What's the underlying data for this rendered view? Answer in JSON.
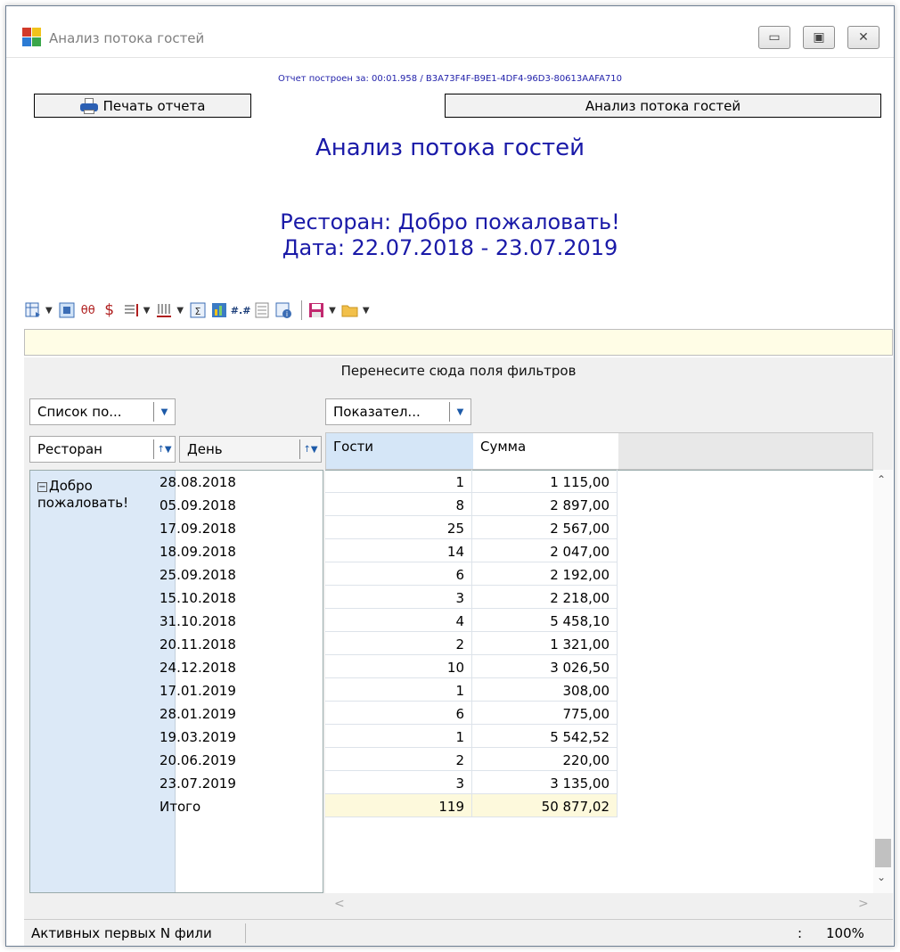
{
  "window": {
    "title": "Анализ потока гостей",
    "controls": [
      "minimize",
      "maximize",
      "close"
    ]
  },
  "report": {
    "meta": "Отчет построен за: 00:01.958 / B3A73F4F-B9E1-4DF4-96D3-80613AAFA710",
    "print_button": "Печать отчета",
    "report_button": "Анализ потока гостей",
    "title": "Анализ потока гостей",
    "restaurant_line": "Ресторан: Добро пожаловать!",
    "date_line": "Дата: 22.07.2018 - 23.07.2019"
  },
  "pivot": {
    "filter_drop_hint": "Перенесите сюда поля фильтров",
    "fields_list_button": "Список по...",
    "measures_button": "Показател...",
    "row_fields": [
      "Ресторан",
      "День"
    ],
    "column_headers": [
      "Гости",
      "Сумма"
    ],
    "restaurant": "Добро пожаловать!",
    "rows": [
      {
        "date": "28.08.2018",
        "guests": "1",
        "sum": "1 115,00"
      },
      {
        "date": "05.09.2018",
        "guests": "8",
        "sum": "2 897,00"
      },
      {
        "date": "17.09.2018",
        "guests": "25",
        "sum": "2 567,00"
      },
      {
        "date": "18.09.2018",
        "guests": "14",
        "sum": "2 047,00"
      },
      {
        "date": "25.09.2018",
        "guests": "6",
        "sum": "2 192,00"
      },
      {
        "date": "15.10.2018",
        "guests": "3",
        "sum": "2 218,00"
      },
      {
        "date": "31.10.2018",
        "guests": "4",
        "sum": "5 458,10"
      },
      {
        "date": "20.11.2018",
        "guests": "2",
        "sum": "1 321,00"
      },
      {
        "date": "24.12.2018",
        "guests": "10",
        "sum": "3 026,50"
      },
      {
        "date": "17.01.2019",
        "guests": "1",
        "sum": "308,00"
      },
      {
        "date": "28.01.2019",
        "guests": "6",
        "sum": "775,00"
      },
      {
        "date": "19.03.2019",
        "guests": "1",
        "sum": "5 542,52"
      },
      {
        "date": "20.06.2019",
        "guests": "2",
        "sum": "220,00"
      },
      {
        "date": "23.07.2019",
        "guests": "3",
        "sum": "3 135,00"
      }
    ],
    "total": {
      "label": "Итого",
      "guests": "119",
      "sum": "50 877,02"
    }
  },
  "statusbar": {
    "left": "Активных первых N фили",
    "colon": ":",
    "zoom": "100%"
  },
  "toolbar_icons": [
    "pivot-layout-icon",
    "field-list-icon",
    "show-totals-icon",
    "currency-icon",
    "align-rows-icon",
    "align-columns-icon",
    "sum-icon",
    "chart-icon",
    "number-format-icon",
    "grid-icon",
    "info-icon",
    "save-icon",
    "open-folder-icon"
  ]
}
